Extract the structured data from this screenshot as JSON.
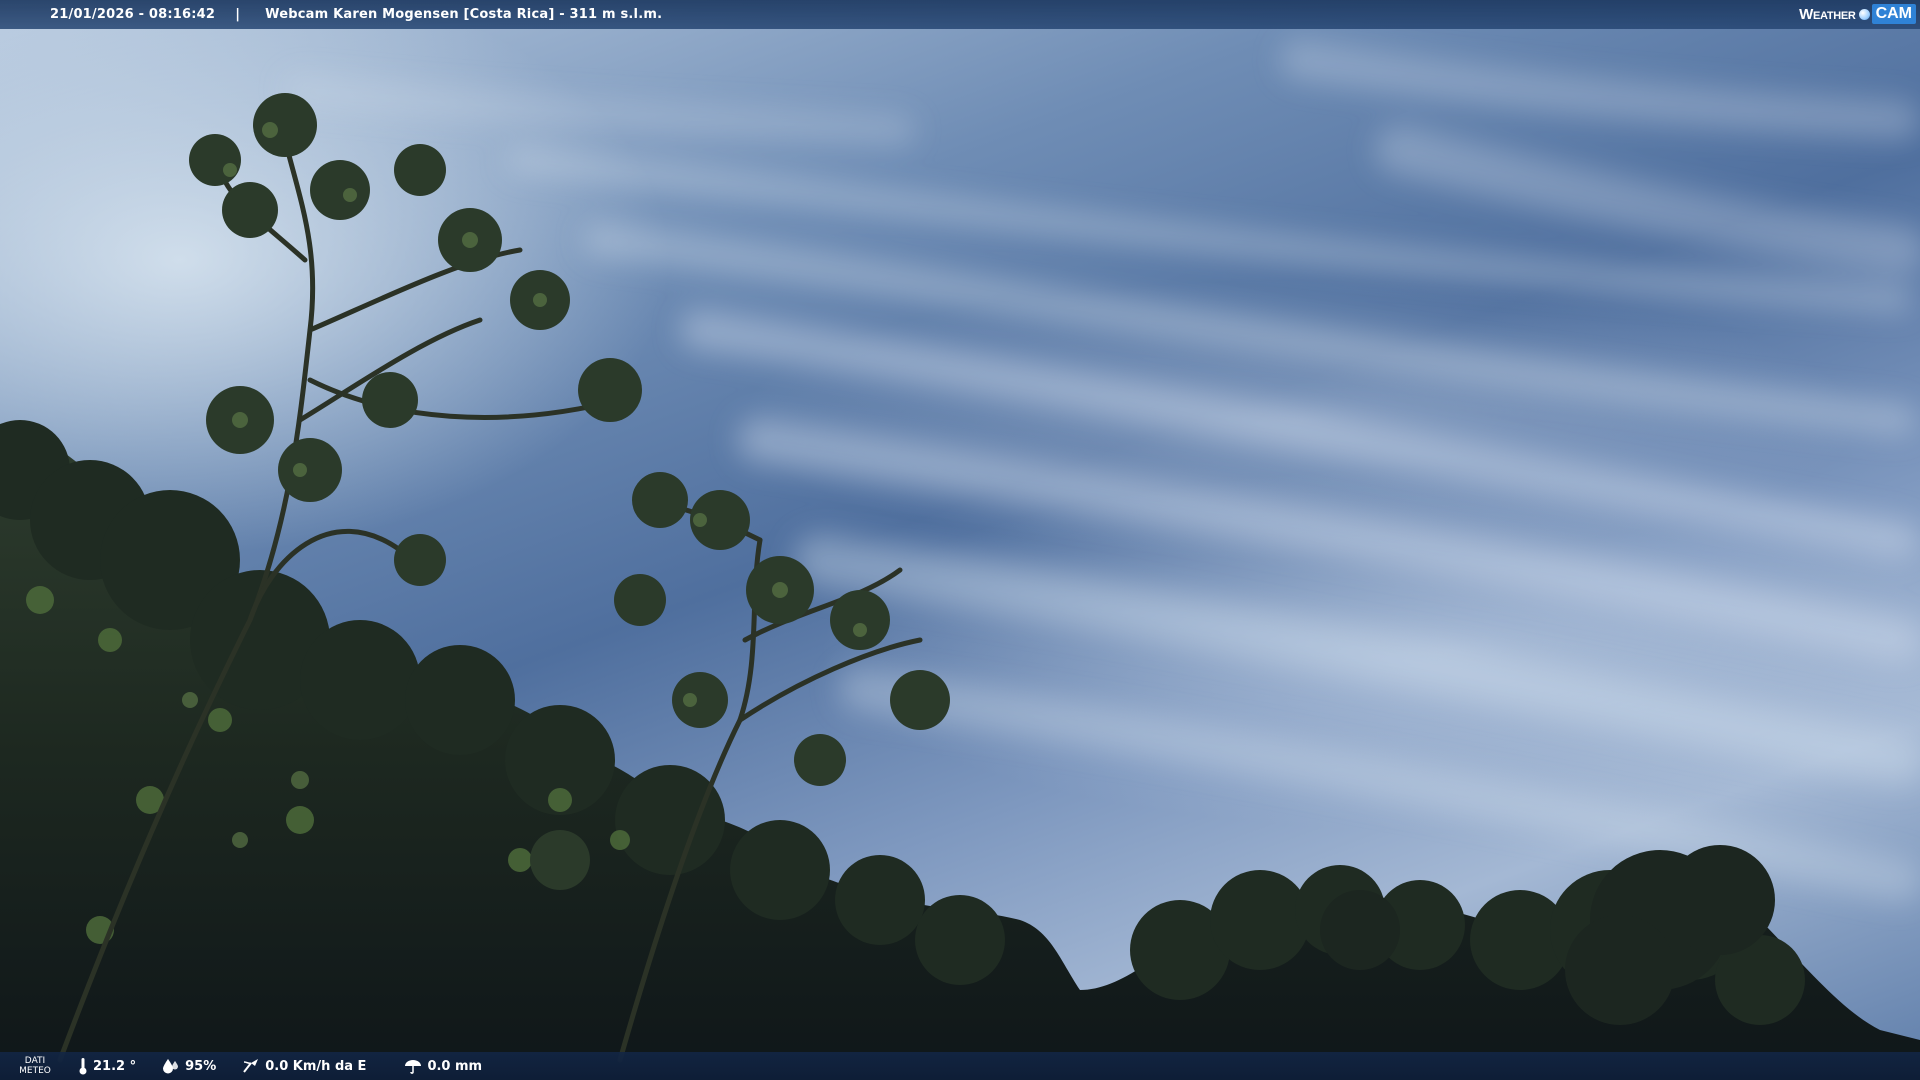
{
  "header": {
    "datetime": "21/01/2026 - 08:16:42",
    "separator": "|",
    "title": "Webcam Karen Mogensen [Costa Rica]  - 311 m s.l.m.",
    "brand_prefix": "Weather",
    "brand_suffix": "CAM"
  },
  "meteo": {
    "label_line1": "DATI",
    "label_line2": "METEO",
    "temperature": "21.2 °",
    "humidity": "95%",
    "wind": "0.0 Km/h da E",
    "rain": "0.0 mm"
  },
  "colors": {
    "bar_background": "#1e3a62",
    "brand_accent": "#2f82d6",
    "foliage": "#1e2a22"
  },
  "icons": {
    "temperature": "thermometer-icon",
    "humidity": "drops-icon",
    "wind": "wind-icon",
    "rain": "rain-umbrella-icon"
  }
}
